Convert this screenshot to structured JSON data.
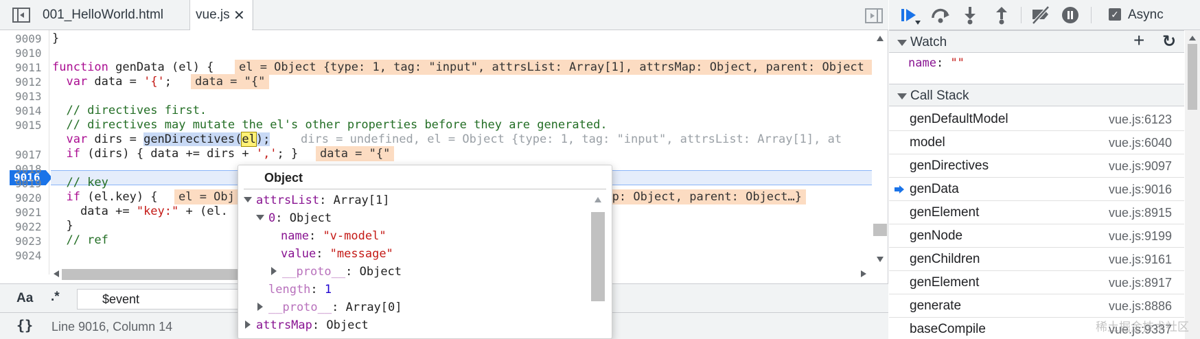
{
  "editor": {
    "tabs": [
      {
        "label": "001_HelloWorld.html"
      },
      {
        "label": "vue.js",
        "close": "✕"
      }
    ],
    "line_numbers": [
      "9009",
      "9010",
      "9011",
      "9012",
      "9013",
      "9014",
      "9015",
      "9016",
      "9017",
      "9018",
      "9019",
      "9020",
      "9021",
      "9022",
      "9023",
      "9024"
    ],
    "current_line": "9016",
    "code": {
      "l9009": "}",
      "l9011_kw": "function",
      "l9011_rest": " genData (el) {",
      "l9012_a": "  var",
      "l9012_b": " data = ",
      "l9012_c": "'{'",
      "l9012_d": ";",
      "l9014": "  // directives first.",
      "l9015": "  // directives may mutate the el's other properties before they are generated.",
      "l9016_a": "  var",
      "l9016_b": " dirs = ",
      "l9016_c": "genDirectives(",
      "l9016_d": "el",
      "l9016_e": ");",
      "l9017_a": "  if",
      "l9017_b": " (dirs) { data += dirs + ",
      "l9017_c": "','",
      "l9017_d": "; }",
      "l9019": "  // key",
      "l9020_a": "  if",
      "l9020_b": " (el.key) {",
      "l9021_a": "    data += ",
      "l9021_b": "\"key:\"",
      "l9021_c": " + (el.",
      "l9022": "  }",
      "l9023": "  // ref"
    },
    "inline_values": {
      "l9011": "el = Object {type: 1, tag: \"input\", attrsList: Array[1], attrsMap: Object, parent: Object",
      "l9012": "data = \"{\"",
      "l9016": "dirs = undefined, el = Object {type: 1, tag: \"input\", attrsList: Array[1], at",
      "l9017": "data = \"{\"",
      "l9020_a": "el = Obj",
      "l9020_b": "attrsMap: Object, parent: Object…}"
    },
    "search": {
      "case_label": "Aa",
      "regex_label": ".*",
      "value": "$event"
    },
    "status": {
      "pretty_print": "{}",
      "cursor": "Line 9016, Column 14"
    }
  },
  "popover": {
    "title": "Object",
    "rows": [
      {
        "key": "attrsList",
        "value": "Array[1]"
      },
      {
        "key": "0",
        "value": "Object"
      },
      {
        "key": "name",
        "value": "\"v-model\""
      },
      {
        "key": "value",
        "value": "\"message\""
      },
      {
        "key": "__proto__",
        "value": "Object"
      },
      {
        "key": "length",
        "value": "1"
      },
      {
        "key": "__proto__",
        "value": "Array[0]"
      },
      {
        "key": "attrsMap",
        "value": "Object"
      }
    ]
  },
  "debugger": {
    "toolbar": {
      "resume_icon": "resume-icon",
      "step_over_icon": "step-over-icon",
      "step_into_icon": "step-into-icon",
      "step_out_icon": "step-out-icon",
      "deactivate_icon": "deactivate-breakpoints-icon",
      "pause_exceptions_icon": "pause-on-exceptions-icon",
      "async_label": "Async",
      "async_checked": true
    },
    "watch": {
      "title": "Watch",
      "add": "+",
      "refresh": "↻",
      "expression_name": "name",
      "expression_value": "\"\""
    },
    "call_stack": {
      "title": "Call Stack",
      "frames": [
        {
          "fn": "genDefaultModel",
          "loc": "vue.js:6123"
        },
        {
          "fn": "model",
          "loc": "vue.js:6040"
        },
        {
          "fn": "genDirectives",
          "loc": "vue.js:9097"
        },
        {
          "fn": "genData",
          "loc": "vue.js:9016",
          "current": true
        },
        {
          "fn": "genElement",
          "loc": "vue.js:8915"
        },
        {
          "fn": "genNode",
          "loc": "vue.js:9199"
        },
        {
          "fn": "genChildren",
          "loc": "vue.js:9161"
        },
        {
          "fn": "genElement",
          "loc": "vue.js:8917"
        },
        {
          "fn": "generate",
          "loc": "vue.js:8886"
        },
        {
          "fn": "baseCompile",
          "loc": "vue.js:9337"
        }
      ]
    }
  },
  "watermark": "稀土掘金技术社区",
  "colors": {
    "accent": "#1a73e8",
    "inline_value_bg": "#fcdcc2",
    "keyword": "#aa0d91",
    "string": "#c41a16",
    "comment": "#236e25"
  }
}
